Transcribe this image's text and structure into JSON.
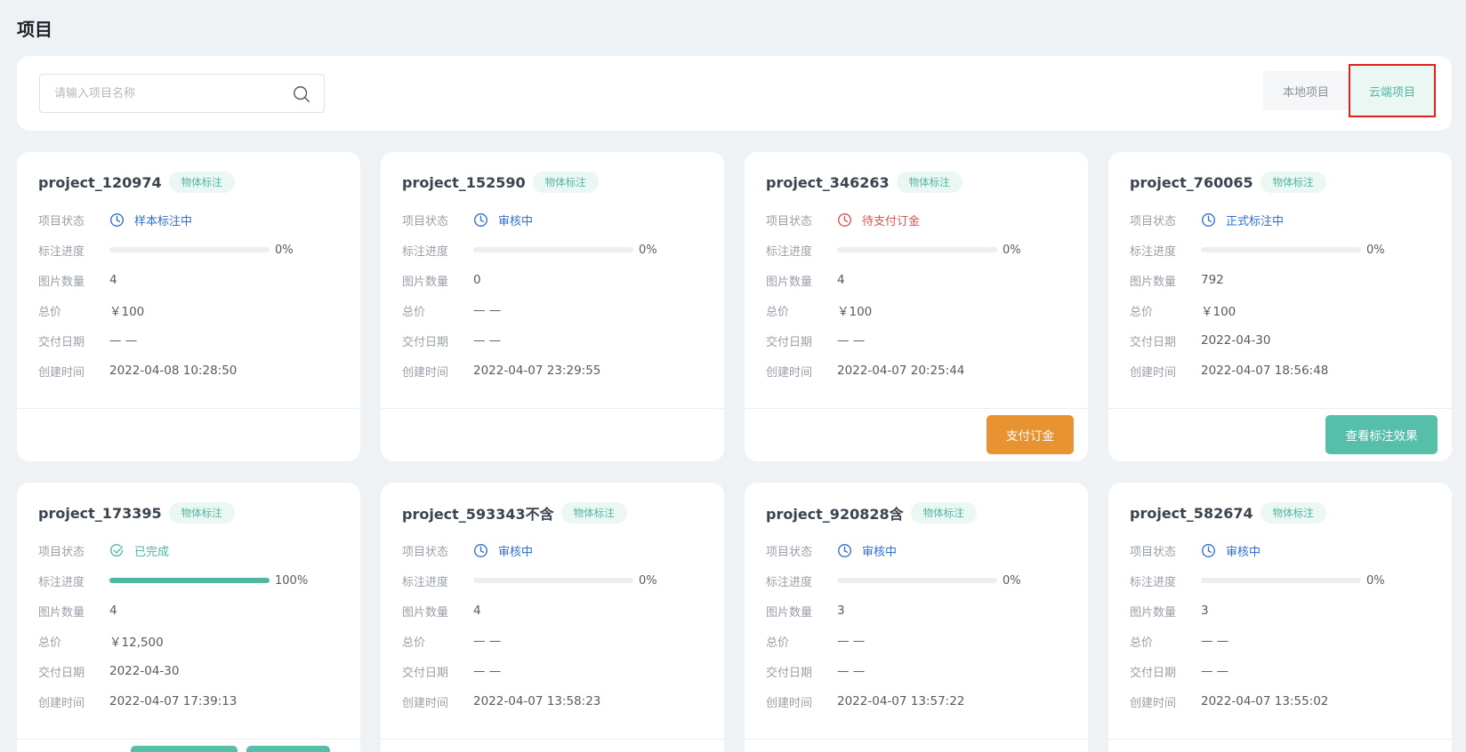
{
  "page_title": "项目",
  "search": {
    "placeholder": "请输入项目名称"
  },
  "tabs": [
    {
      "label": "本地项目",
      "active": false
    },
    {
      "label": "云端项目",
      "active": true
    }
  ],
  "colors": {
    "accent": "#52b5a3",
    "pay": "#e89332",
    "review": "#2f6fd0",
    "pending": "#d9534f",
    "done": "#52b5a3"
  },
  "labels": {
    "status": "项目状态",
    "progress": "标注进度",
    "image_count": "图片数量",
    "price": "总价",
    "delivery": "交付日期",
    "created": "创建时间"
  },
  "cards": [
    {
      "name": "project_120974",
      "tag": "物体标注",
      "status": "样本标注中",
      "status_type": "review",
      "status_icon": "clock-icon",
      "progress_pct": 0,
      "progress_text": "0%",
      "image_count": "4",
      "price": "￥100",
      "delivery": "— —",
      "created": "2022-04-08 10:28:50",
      "button": ""
    },
    {
      "name": "project_152590",
      "tag": "物体标注",
      "status": "审核中",
      "status_type": "review",
      "status_icon": "clock-icon",
      "progress_pct": 0,
      "progress_text": "0%",
      "image_count": "0",
      "price": "— —",
      "delivery": "— —",
      "created": "2022-04-07 23:29:55",
      "button": ""
    },
    {
      "name": "project_346263",
      "tag": "物体标注",
      "status": "待支付订金",
      "status_type": "pending",
      "status_icon": "clock-icon",
      "progress_pct": 0,
      "progress_text": "0%",
      "image_count": "4",
      "price": "￥100",
      "delivery": "— —",
      "created": "2022-04-07 20:25:44",
      "button": "支付订金"
    },
    {
      "name": "project_760065",
      "tag": "物体标注",
      "status": "正式标注中",
      "status_type": "review",
      "status_icon": "clock-icon",
      "progress_pct": 0,
      "progress_text": "0%",
      "image_count": "792",
      "price": "￥100",
      "delivery": "2022-04-30",
      "created": "2022-04-07 18:56:48",
      "button": "查看标注效果"
    },
    {
      "name": "project_173395",
      "tag": "物体标注",
      "status": "已完成",
      "status_type": "done",
      "status_icon": "check-circle-icon",
      "progress_pct": 100,
      "progress_text": "100%",
      "image_count": "4",
      "price": "￥12,500",
      "delivery": "2022-04-30",
      "created": "2022-04-07 17:39:13",
      "button": ""
    },
    {
      "name": "project_593343不含",
      "tag": "物体标注",
      "status": "审核中",
      "status_type": "review",
      "status_icon": "clock-icon",
      "progress_pct": 0,
      "progress_text": "0%",
      "image_count": "4",
      "price": "— —",
      "delivery": "— —",
      "created": "2022-04-07 13:58:23",
      "button": ""
    },
    {
      "name": "project_920828含",
      "tag": "物体标注",
      "status": "审核中",
      "status_type": "review",
      "status_icon": "clock-icon",
      "progress_pct": 0,
      "progress_text": "0%",
      "image_count": "3",
      "price": "— —",
      "delivery": "— —",
      "created": "2022-04-07 13:57:22",
      "button": ""
    },
    {
      "name": "project_582674",
      "tag": "物体标注",
      "status": "审核中",
      "status_type": "review",
      "status_icon": "clock-icon",
      "progress_pct": 0,
      "progress_text": "0%",
      "image_count": "3",
      "price": "— —",
      "delivery": "— —",
      "created": "2022-04-07 13:55:02",
      "button": ""
    }
  ]
}
